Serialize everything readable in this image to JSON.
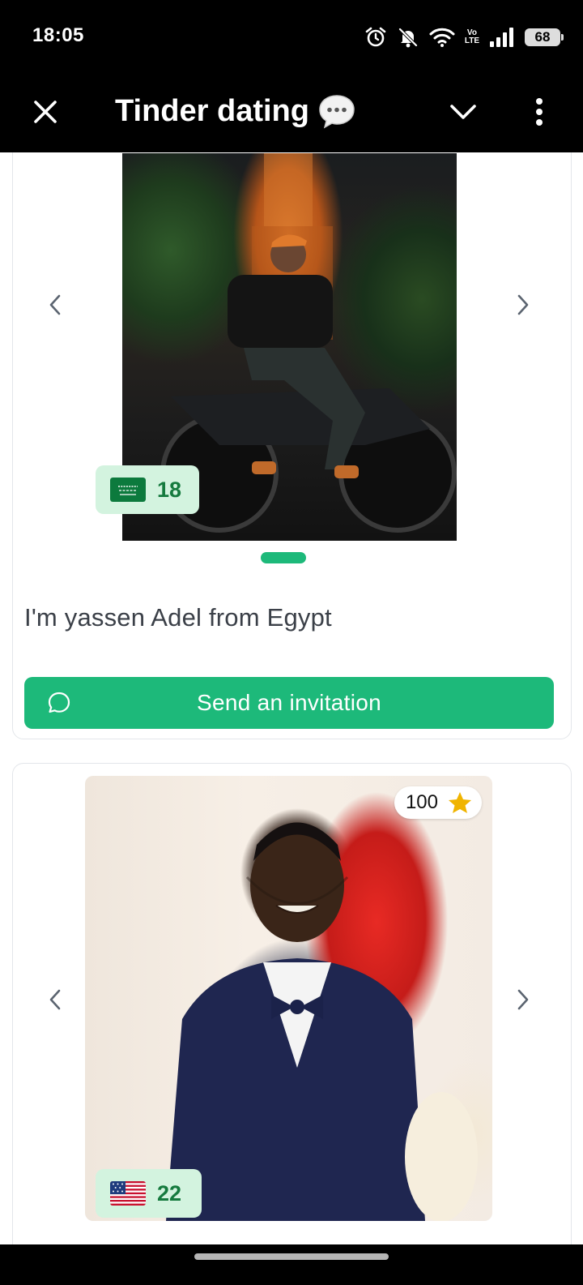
{
  "status_bar": {
    "time": "18:05",
    "network": "Vo\nLTE",
    "battery": "68"
  },
  "header": {
    "title": "Tinder dating",
    "close_icon": "close-icon",
    "title_icon": "chat-bubble-icon",
    "collapse_icon": "chevron-down-icon",
    "menu_icon": "more-vertical-icon"
  },
  "profiles": [
    {
      "flag": "saudi-arabia-flag",
      "age": "18",
      "bio": "I'm yassen Adel from Egypt",
      "invite_label": "Send an invitation",
      "photo_index": 0,
      "photo_count": 1
    },
    {
      "flag": "usa-flag",
      "age": "22",
      "rating": "100"
    }
  ],
  "colors": {
    "accent": "#1db97a",
    "badge_bg": "#d3f3df",
    "badge_text": "#157a3e",
    "star": "#f0b400"
  }
}
